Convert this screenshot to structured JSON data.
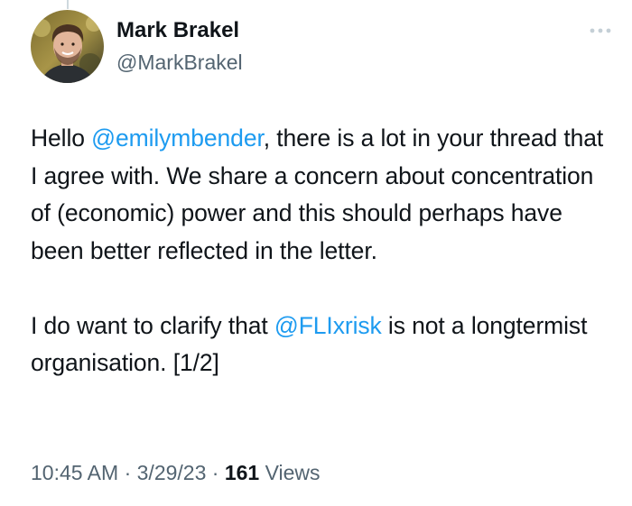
{
  "author": {
    "name": "Mark Brakel",
    "handle": "@MarkBrakel"
  },
  "tweet": {
    "p1_before": "Hello ",
    "p1_mention": "@emilymbender",
    "p1_after": ", there is a lot in your thread that I agree with. We share a concern about concentration of (economic) power and this should perhaps have been better reflected in the letter.",
    "p2_before": "I do want to clarify that ",
    "p2_mention": "@FLIxrisk",
    "p2_after": " is not a longtermist organisation. [1/2]"
  },
  "meta": {
    "time": "10:45 AM",
    "sep1": " · ",
    "date": "3/29/23",
    "sep2": " · ",
    "views_count": "161",
    "views_label": " Views"
  },
  "icons": {
    "more": "more-dots-icon",
    "avatar": "profile-photo"
  },
  "colors": {
    "mention": "#1d9bf0",
    "secondary_text": "#536471",
    "primary_text": "#0f1419"
  }
}
